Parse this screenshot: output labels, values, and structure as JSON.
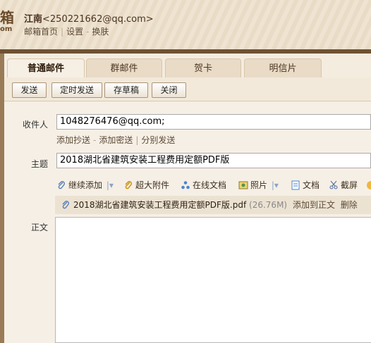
{
  "header": {
    "logo_char": "箱",
    "logo_sub": "om",
    "user_name": "江南",
    "user_email": "<250221662@qq.com>",
    "links": [
      "邮箱首页",
      "设置",
      "换肤"
    ]
  },
  "tabs": [
    "普通邮件",
    "群邮件",
    "贺卡",
    "明信片"
  ],
  "toolbar": {
    "send": "发送",
    "scheduled": "定时发送",
    "draft": "存草稿",
    "close": "关闭"
  },
  "form": {
    "to_label": "收件人",
    "to_value": "1048276476@qq.com;",
    "cc": "添加抄送",
    "bcc": "添加密送",
    "separate": "分别发送",
    "subject_label": "主题",
    "subject_value": "2018湖北省建筑安装工程费用定额PDF版",
    "body_label": "正文"
  },
  "attach_toolbar": {
    "continue_add": "继续添加",
    "large_attach": "超大附件",
    "online_doc": "在线文档",
    "photo": "照片",
    "document": "文档",
    "screenshot": "截屏"
  },
  "attachment": {
    "filename": "2018湖北省建筑安装工程费用定额PDF版.pdf",
    "size": "(26.76M)",
    "add_to_body": "添加到正文",
    "delete": "删除"
  },
  "colors": {
    "header_bar": "#6f5132",
    "panel": "#f6efe5",
    "link": "#5c4a36"
  }
}
